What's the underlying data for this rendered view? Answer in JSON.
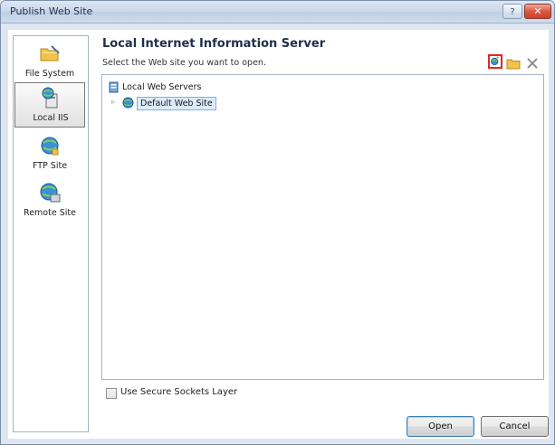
{
  "window": {
    "title": "Publish Web Site",
    "help_label": "?",
    "close_label": "✕"
  },
  "sidebar": {
    "items": [
      {
        "label": "File System",
        "icon": "folder-icon",
        "selected": false
      },
      {
        "label": "Local IIS",
        "icon": "local-iis-icon",
        "selected": true
      },
      {
        "label": "FTP Site",
        "icon": "ftp-globe-icon",
        "selected": false
      },
      {
        "label": "Remote Site",
        "icon": "remote-site-icon",
        "selected": false
      }
    ]
  },
  "main": {
    "heading": "Local Internet Information Server",
    "instruction": "Select the Web site you want to open.",
    "toolbar": {
      "new_icon": "create-web-application-icon",
      "folder_icon": "create-virtual-directory-icon",
      "delete_icon": "delete-icon"
    },
    "tree": {
      "root": "Local Web Servers",
      "expander": "▹",
      "children": [
        {
          "label": "Default Web Site",
          "selected": true
        }
      ]
    }
  },
  "options": {
    "ssl_label": "Use Secure Sockets Layer",
    "ssl_checked": false
  },
  "buttons": {
    "open": "Open",
    "cancel": "Cancel"
  },
  "colors": {
    "highlight_border": "#e2271d",
    "selection_bg": "#dcebfc"
  }
}
